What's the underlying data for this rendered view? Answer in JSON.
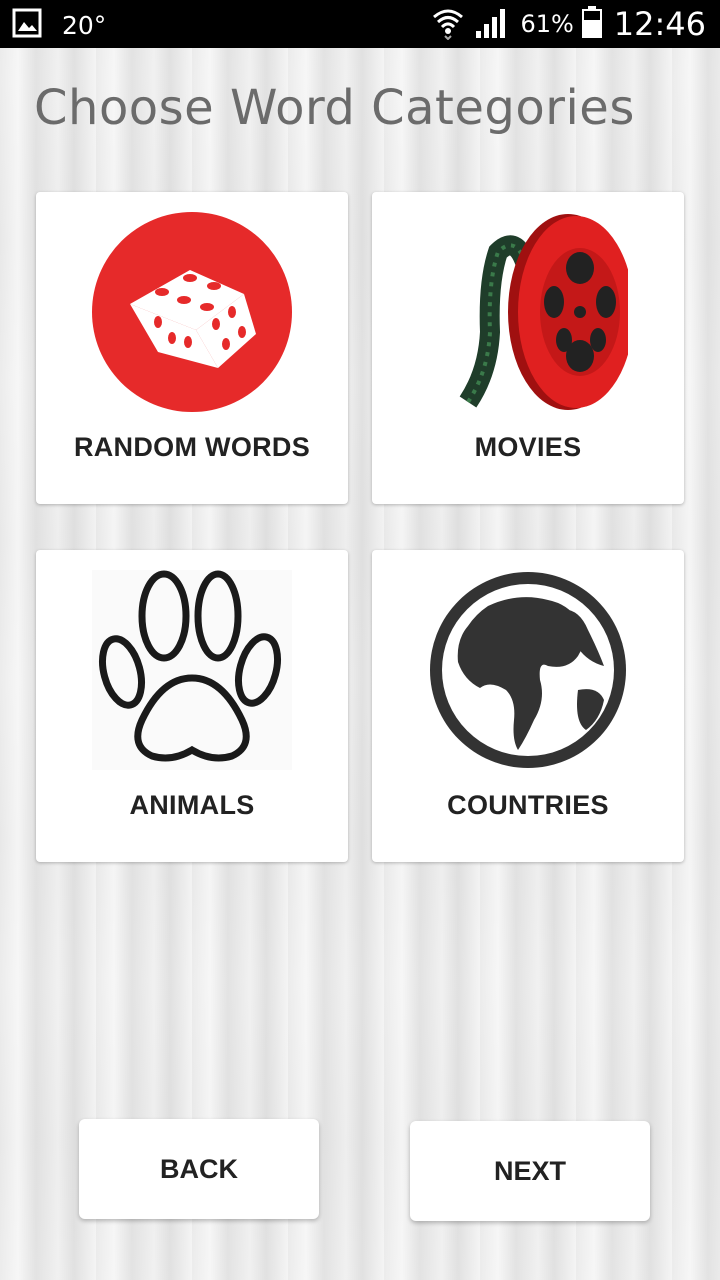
{
  "status_bar": {
    "temperature": "20°",
    "battery_percent": "61%",
    "time": "12:46",
    "icons": [
      "gallery-icon",
      "wifi-icon",
      "signal-icon",
      "battery-icon"
    ]
  },
  "page_title": "Choose Word Categories",
  "categories": [
    {
      "label": "RANDOM WORDS",
      "icon": "dice-icon",
      "color": "#e62a2a"
    },
    {
      "label": "MOVIES",
      "icon": "film-reel-icon",
      "color": "#d81e1e"
    },
    {
      "label": "ANIMALS",
      "icon": "paw-icon",
      "color": "#1a1a1a"
    },
    {
      "label": "COUNTRIES",
      "icon": "globe-icon",
      "color": "#333333"
    }
  ],
  "buttons": {
    "back_label": "BACK",
    "next_label": "NEXT"
  }
}
